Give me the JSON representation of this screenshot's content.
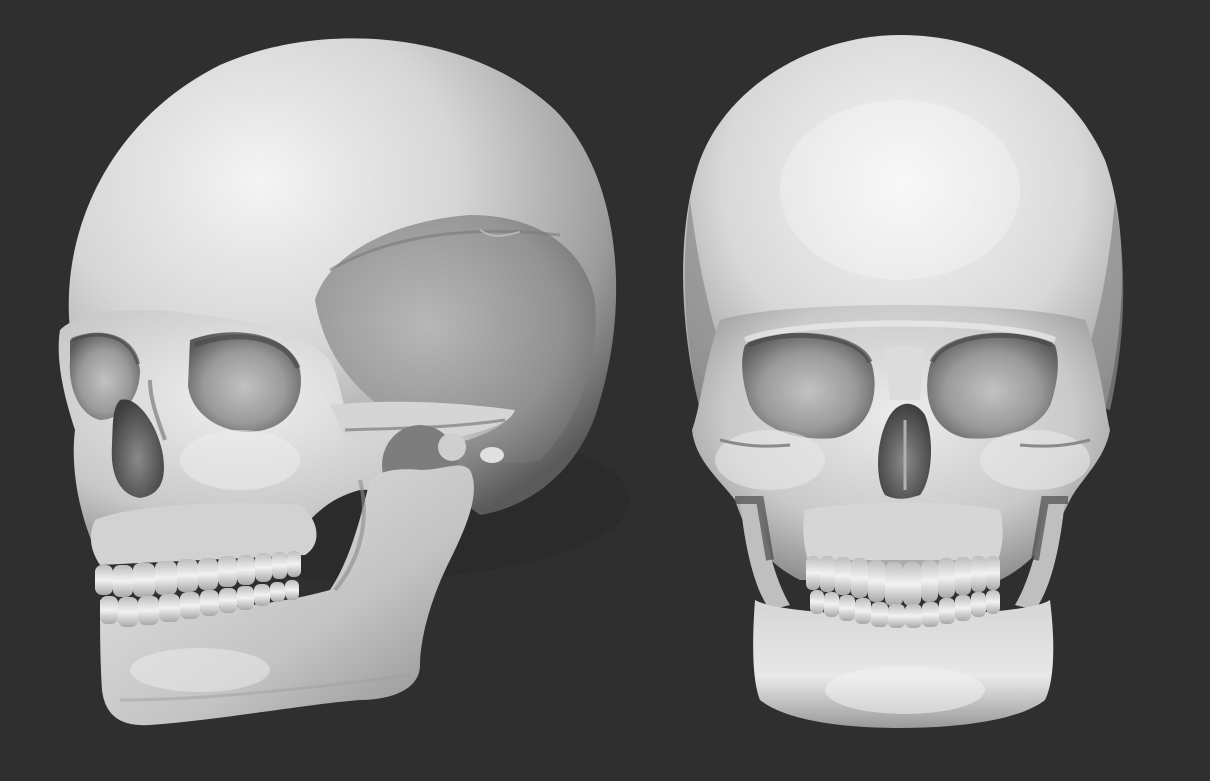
{
  "scene": {
    "background_color": "#2f2f2f",
    "objects": [
      {
        "name": "skull-three-quarter-view",
        "material_color": "#d9d9d9"
      },
      {
        "name": "skull-front-view",
        "material_color": "#d9d9d9"
      }
    ]
  }
}
